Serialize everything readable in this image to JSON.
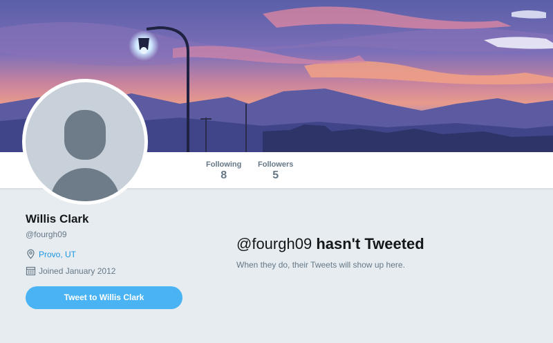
{
  "profile": {
    "name": "Willis Clark",
    "handle": "@fourgh09",
    "location": "Provo, UT",
    "joined": "Joined January 2012"
  },
  "stats": {
    "following_label": "Following",
    "following_count": "8",
    "followers_label": "Followers",
    "followers_count": "5"
  },
  "actions": {
    "tweet_to_label": "Tweet to Willis Clark"
  },
  "timeline": {
    "empty_handle": "@fourgh09",
    "empty_rest": "hasn't Tweeted",
    "empty_subtitle": "When they do, their Tweets will show up here."
  },
  "icons": {
    "location": "map-pin-icon",
    "joined": "calendar-icon"
  },
  "colors": {
    "link": "#1b95e0",
    "button": "#4ab3f4",
    "background": "#e6ecf0",
    "text_secondary": "#657786"
  }
}
